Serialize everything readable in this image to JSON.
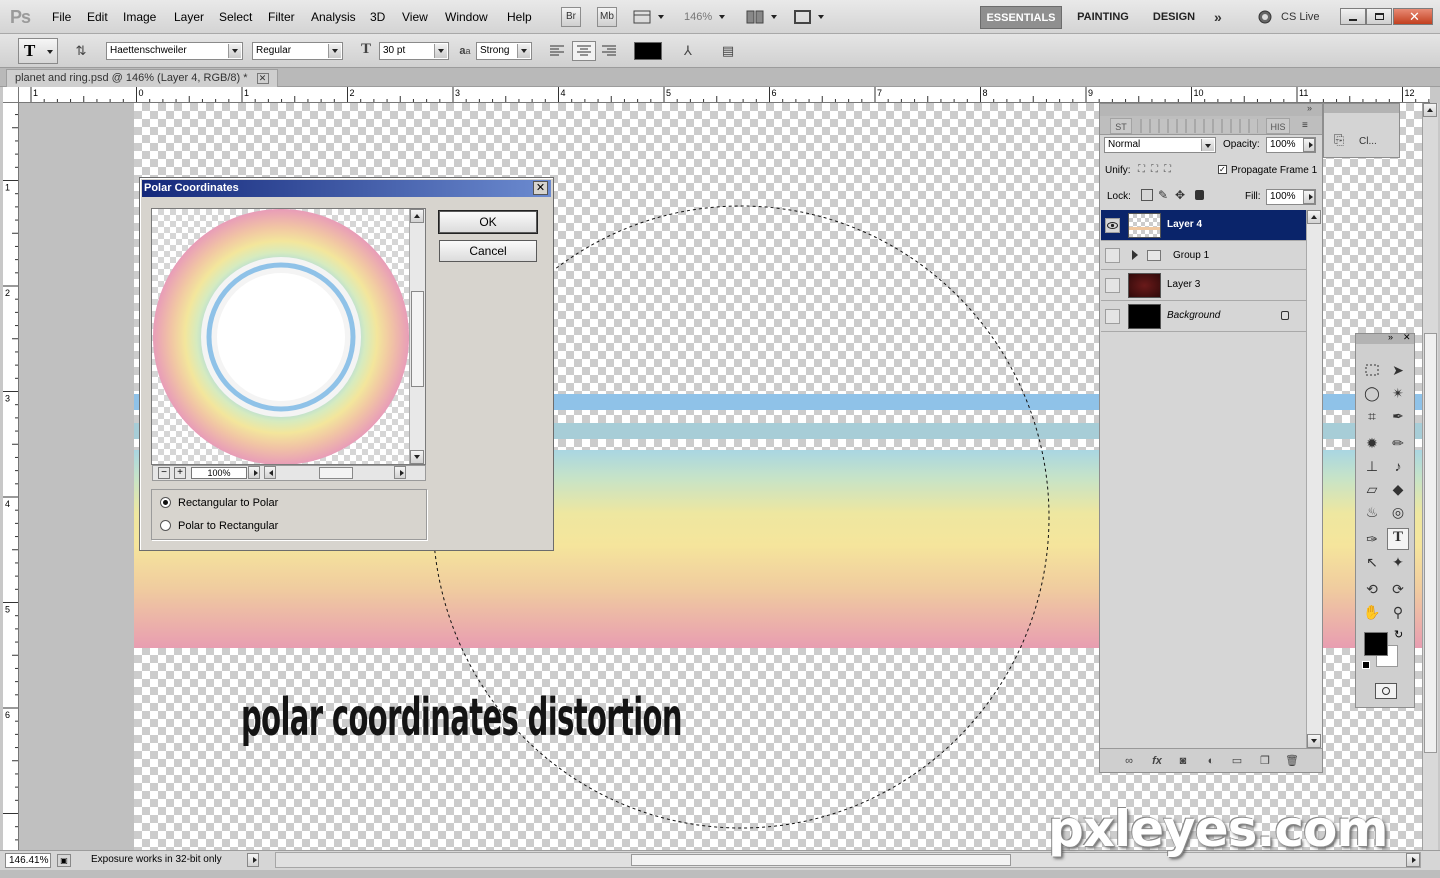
{
  "app": {
    "logo": "Ps"
  },
  "menu": [
    "File",
    "Edit",
    "Image",
    "Layer",
    "Select",
    "Filter",
    "Analysis",
    "3D",
    "View",
    "Window",
    "Help"
  ],
  "topbar": {
    "bridge": "Br",
    "minibridge": "Mb",
    "zoom": "146%"
  },
  "workspaces": [
    "ESSENTIALS",
    "PAINTING",
    "DESIGN"
  ],
  "cs_live": "CS Live",
  "options": {
    "font_family": "Haettenschweiler",
    "font_style": "Regular",
    "font_size": "30 pt",
    "aa_label": "a",
    "antialias": "Strong",
    "text_color": "#000000"
  },
  "document": {
    "tab_title": "planet and ring.psd @ 146% (Layer 4, RGB/8) *"
  },
  "ruler": {
    "h_labels": [
      "1",
      "0",
      "1",
      "2",
      "3",
      "4",
      "5",
      "6",
      "7",
      "8",
      "9",
      "10",
      "11",
      "12"
    ],
    "v_labels": [
      "1",
      "2",
      "3",
      "4",
      "5",
      "6"
    ]
  },
  "canvas": {
    "text": "polar coordinates distortion"
  },
  "watermark": "pxleyes.com",
  "dialog": {
    "title": "Polar Coordinates",
    "ok": "OK",
    "cancel": "Cancel",
    "zoom": "100%",
    "options": [
      {
        "label": "Rectangular to Polar",
        "checked": true
      },
      {
        "label": "Polar to Rectangular",
        "checked": false
      }
    ]
  },
  "layers_panel": {
    "tabs": [
      "ST",
      "HIS"
    ],
    "blend_mode": "Normal",
    "opacity_label": "Opacity:",
    "opacity": "100%",
    "unify_label": "Unify:",
    "propagate_label": "Propagate Frame 1",
    "lock_label": "Lock:",
    "fill_label": "Fill:",
    "fill": "100%",
    "layers": [
      {
        "name": "Layer 4",
        "selected": true,
        "visible": true
      },
      {
        "name": "Group 1",
        "selected": false,
        "visible": false
      },
      {
        "name": "Layer 3",
        "selected": false,
        "visible": false
      },
      {
        "name": "Background",
        "selected": false,
        "visible": false
      }
    ]
  },
  "mini_panel": {
    "label": "Cl..."
  },
  "status": {
    "zoom": "146.41%",
    "message": "Exposure works in 32-bit only"
  },
  "colors": {
    "foreground": "#000000",
    "background": "#ffffff",
    "selected_layer": "#0a246a"
  }
}
